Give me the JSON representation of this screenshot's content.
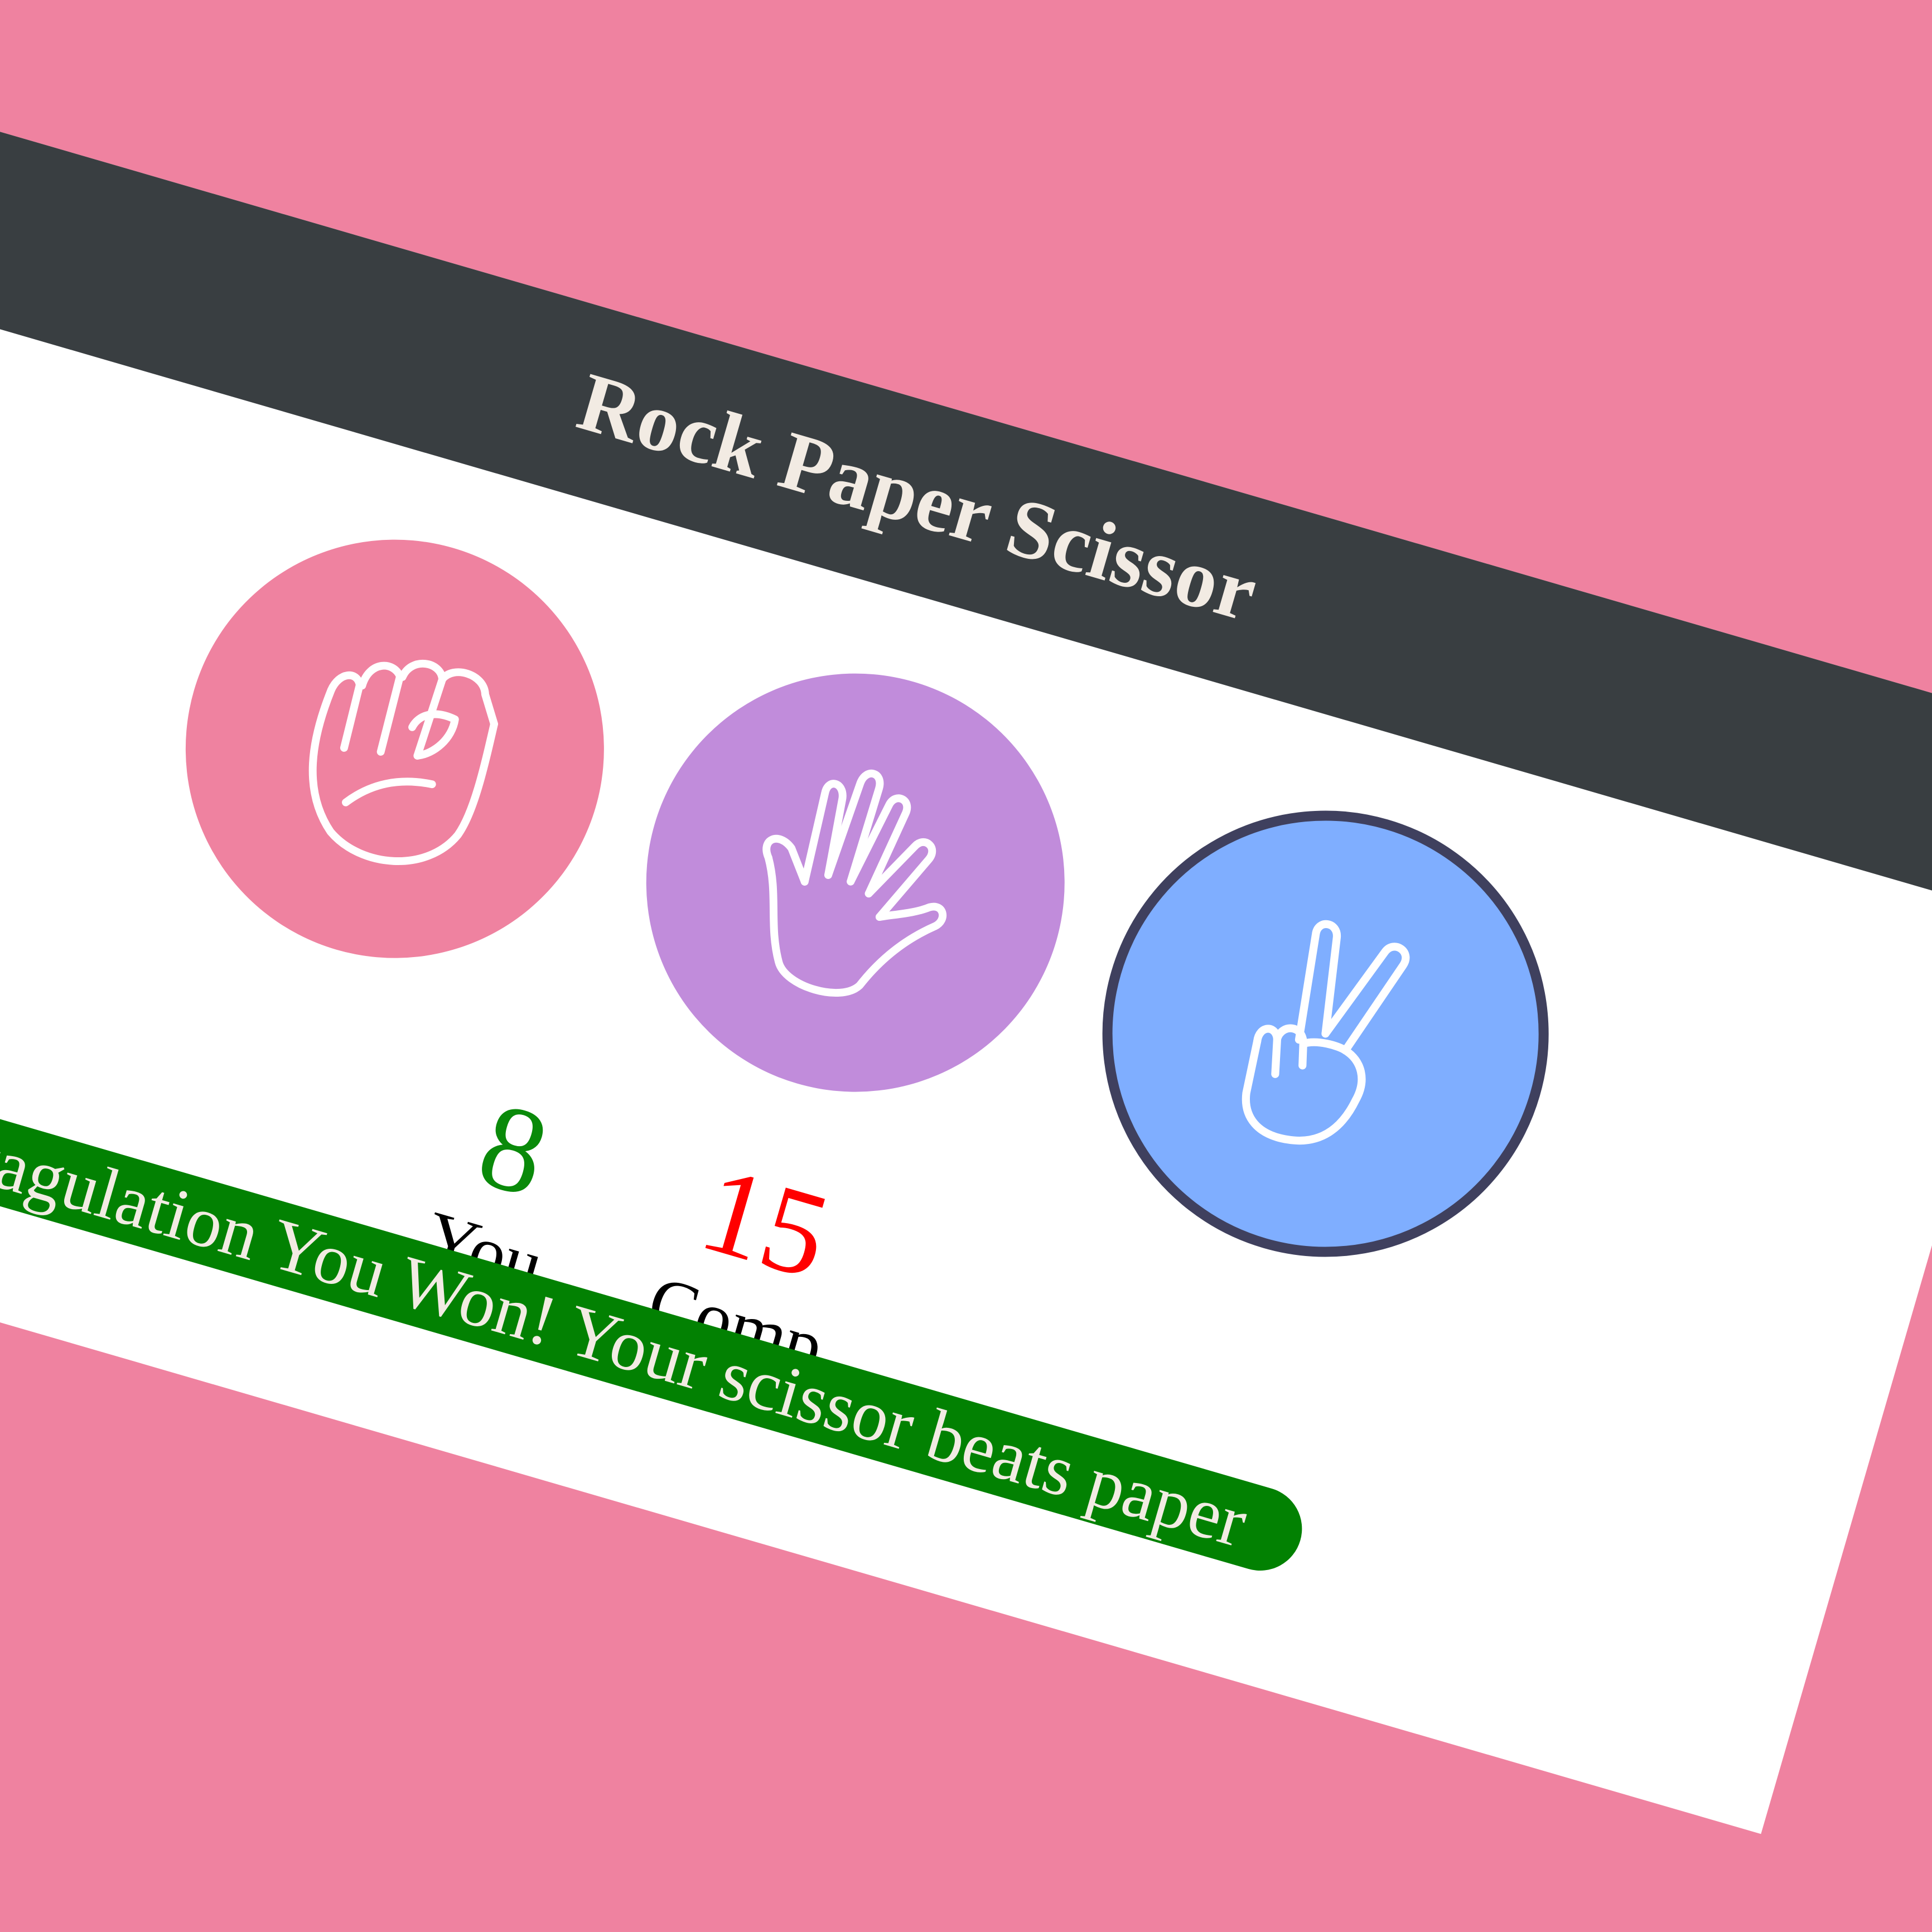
{
  "title": "Rock Paper Scissor",
  "choices": [
    {
      "id": "rock",
      "icon": "fist-icon",
      "color": "#ef82a0"
    },
    {
      "id": "paper",
      "icon": "open-hand-icon",
      "color": "#c18cdb"
    },
    {
      "id": "scissor",
      "icon": "victory-hand-icon",
      "color": "#7faeff",
      "selected": true
    }
  ],
  "score": {
    "user": "8",
    "user_label": "You",
    "comp": "15",
    "comp_label": "Comp"
  },
  "message": "Congragulation You Won! Your scissor beats paper",
  "colors": {
    "background": "#ef82a0",
    "header": "#393e41",
    "win": "#028102",
    "user_score": "#0a8a0a",
    "comp_score": "#ff0000",
    "selected_border": "#3f405e"
  }
}
